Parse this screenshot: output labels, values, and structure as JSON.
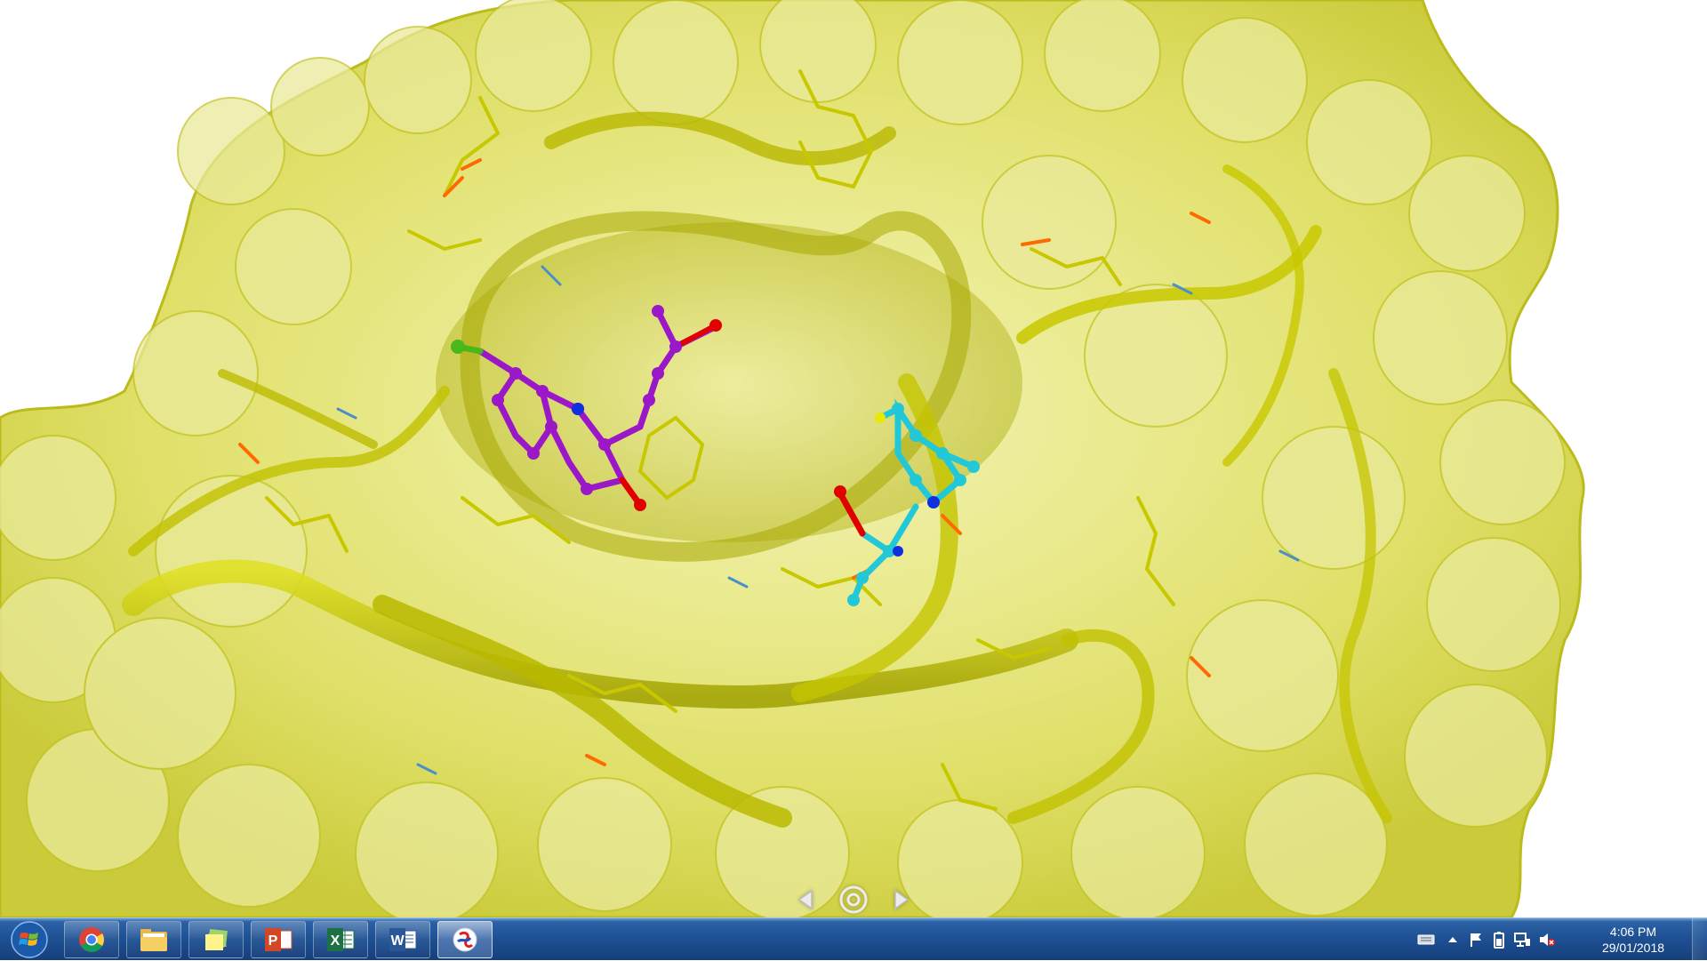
{
  "viewer": {
    "colors": {
      "surface": "#e2e24c",
      "surface_dark": "#a3a300",
      "ribbon": "#c9c900",
      "stick": "#c8c800",
      "oxygen": "#ff6a00",
      "nitrogen": "#4a90c8",
      "ligand_1": "#9a18c8",
      "ligand_2": "#22c8d8",
      "ligand_o": "#e00000",
      "ligand_n": "#1030e0",
      "chlorine": "#4ab81a"
    },
    "nav": {
      "prev_icon": "chevron-left-icon",
      "rotate_icon": "rotate-center-icon",
      "next_icon": "chevron-right-icon"
    }
  },
  "taskbar": {
    "start_icon": "windows-logo-icon",
    "apps": [
      {
        "name": "chrome",
        "icon": "chrome-icon",
        "active": false
      },
      {
        "name": "file-explorer",
        "icon": "folder-icon",
        "active": false
      },
      {
        "name": "notes",
        "icon": "notes-icon",
        "active": false
      },
      {
        "name": "powerpoint",
        "icon": "powerpoint-icon",
        "active": false
      },
      {
        "name": "excel",
        "icon": "excel-icon",
        "active": false
      },
      {
        "name": "word",
        "icon": "word-icon",
        "active": false
      },
      {
        "name": "molecular-viewer",
        "icon": "molecule-app-icon",
        "active": true
      }
    ],
    "tray": {
      "icons": [
        "keyboard-icon",
        "show-hidden-icons-chevron",
        "action-center-flag-icon",
        "battery-icon",
        "network-icon",
        "volume-muted-icon"
      ],
      "time": "4:06 PM",
      "date": "29/01/2018"
    }
  }
}
